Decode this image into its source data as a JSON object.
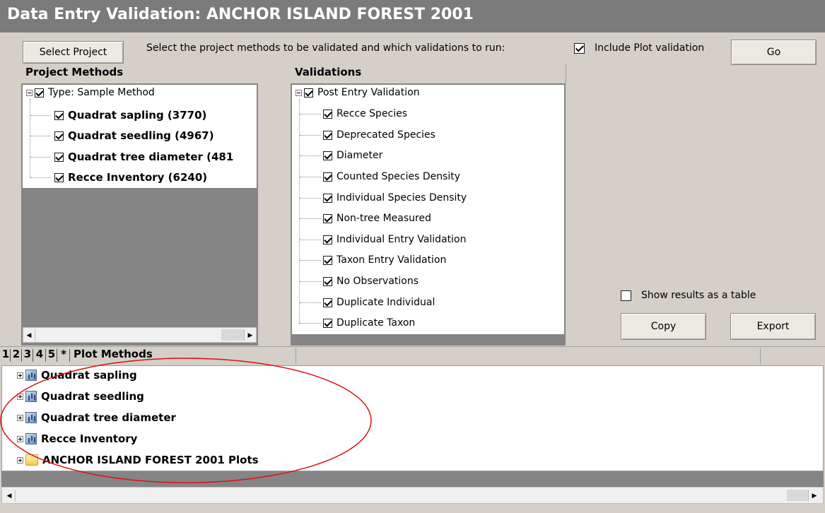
{
  "window": {
    "title": "Data Entry Validation: ANCHOR ISLAND FOREST 2001"
  },
  "toolbar": {
    "select_project": "Select Project",
    "instruction": "Select the project methods to be validated and which validations to run:",
    "include_plot_label": "Include Plot validation",
    "include_plot_checked": true,
    "go": "Go"
  },
  "project_methods": {
    "header": "Project Methods",
    "root": "Type: Sample Method",
    "items": [
      "Quadrat sapling (3770)",
      "Quadrat seedling (4967)",
      "Quadrat tree diameter (481",
      "Recce Inventory (6240)"
    ]
  },
  "validations": {
    "header": "Validations",
    "root": "Post Entry Validation",
    "items": [
      "Recce Species",
      "Deprecated Species",
      "Diameter",
      "Counted Species Density",
      "Individual Species Density",
      "Non-tree Measured",
      "Individual Entry Validation",
      "Taxon Entry Validation",
      "No Observations",
      "Duplicate Individual",
      "Duplicate Taxon"
    ]
  },
  "results": {
    "show_table_label": "Show results as a table",
    "show_table_checked": false,
    "copy": "Copy",
    "export": "Export"
  },
  "plot_tabs": {
    "tabs": [
      "1",
      "2",
      "3",
      "4",
      "5",
      "*"
    ],
    "title": "Plot Methods"
  },
  "plot_methods": [
    {
      "label": "Quadrat sapling",
      "icon": "plot-method-icon"
    },
    {
      "label": "Quadrat seedling",
      "icon": "plot-method-icon"
    },
    {
      "label": "Quadrat tree diameter",
      "icon": "plot-method-icon"
    },
    {
      "label": "Recce Inventory",
      "icon": "plot-method-icon"
    },
    {
      "label": "ANCHOR ISLAND FOREST 2001 Plots",
      "icon": "folder-icon"
    }
  ],
  "annotation": {
    "color": "#e01010",
    "shape": "ellipse"
  }
}
